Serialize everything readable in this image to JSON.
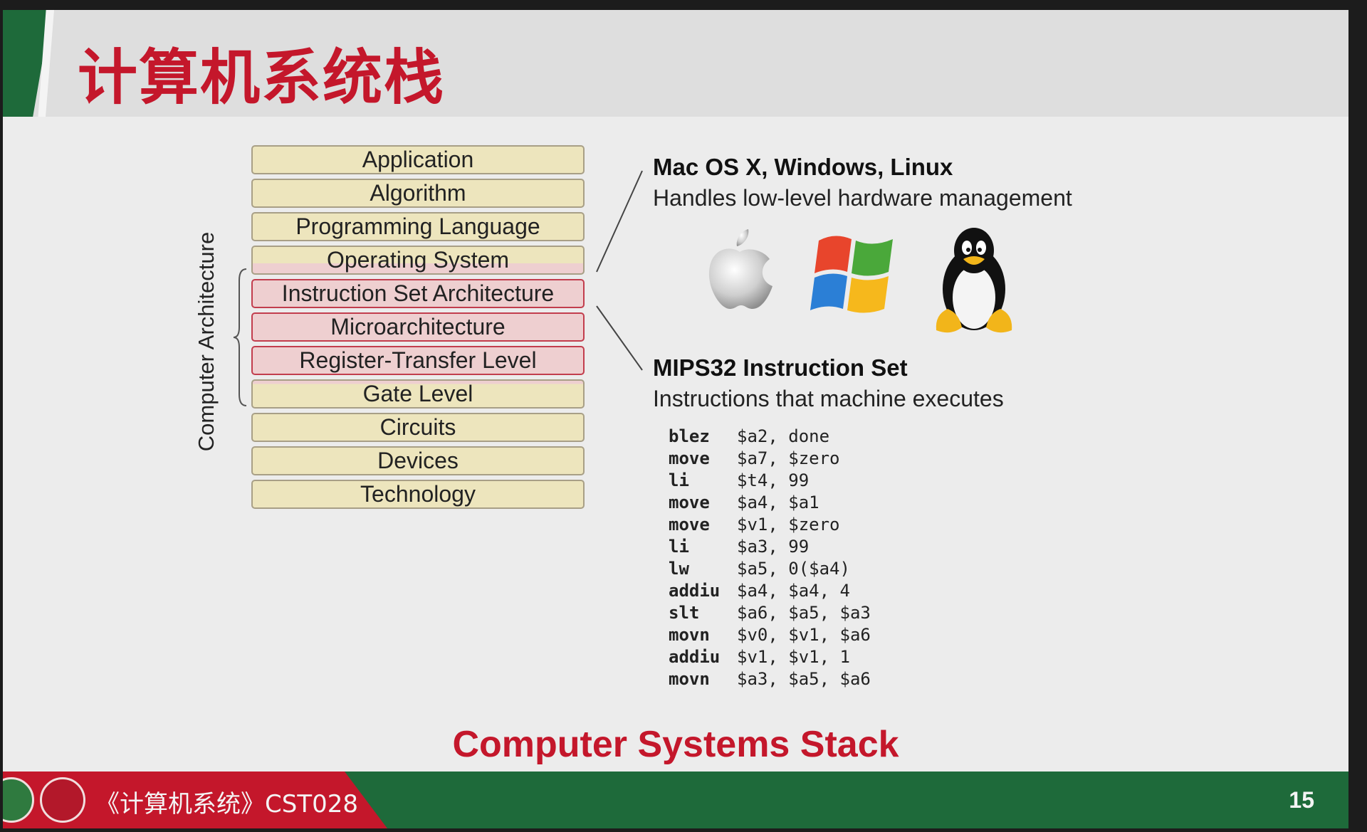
{
  "slide": {
    "title": "计算机系统栈",
    "caption": "Computer Systems Stack",
    "page_number": "15",
    "footer_course": "《计算机系统》CST028"
  },
  "stack": {
    "side_label": "Computer Architecture",
    "layers": [
      {
        "label": "Application",
        "group": "outer"
      },
      {
        "label": "Algorithm",
        "group": "outer"
      },
      {
        "label": "Programming Language",
        "group": "outer"
      },
      {
        "label": "Operating System",
        "group": "boundary-top"
      },
      {
        "label": "Instruction Set Architecture",
        "group": "architecture"
      },
      {
        "label": "Microarchitecture",
        "group": "architecture"
      },
      {
        "label": "Register-Transfer Level",
        "group": "architecture"
      },
      {
        "label": "Gate Level",
        "group": "boundary-bottom"
      },
      {
        "label": "Circuits",
        "group": "outer"
      },
      {
        "label": "Devices",
        "group": "outer"
      },
      {
        "label": "Technology",
        "group": "outer"
      }
    ]
  },
  "os": {
    "heading": "Mac OS X, Windows, Linux",
    "description": "Handles low-level hardware management",
    "logos": [
      "apple-logo-icon",
      "windows-logo-icon",
      "linux-tux-icon"
    ]
  },
  "isa": {
    "heading": "MIPS32 Instruction Set",
    "description": "Instructions that machine executes",
    "code": [
      {
        "op": "blez",
        "args": "$a2, done"
      },
      {
        "op": "move",
        "args": "$a7, $zero"
      },
      {
        "op": "li",
        "args": "$t4, 99"
      },
      {
        "op": "move",
        "args": "$a4, $a1"
      },
      {
        "op": "move",
        "args": "$v1, $zero"
      },
      {
        "op": "li",
        "args": "$a3, 99"
      },
      {
        "op": "lw",
        "args": "$a5, 0($a4)"
      },
      {
        "op": "addiu",
        "args": "$a4, $a4, 4"
      },
      {
        "op": "slt",
        "args": "$a6, $a5, $a3"
      },
      {
        "op": "movn",
        "args": "$v0, $v1, $a6"
      },
      {
        "op": "addiu",
        "args": "$v1, $v1, 1"
      },
      {
        "op": "movn",
        "args": "$a3, $a5, $a6"
      }
    ]
  },
  "colors": {
    "title_red": "#c4172b",
    "footer_green": "#1e6a3a",
    "layer_tan": "#ede5bd",
    "layer_pink": "#eecfd0"
  }
}
